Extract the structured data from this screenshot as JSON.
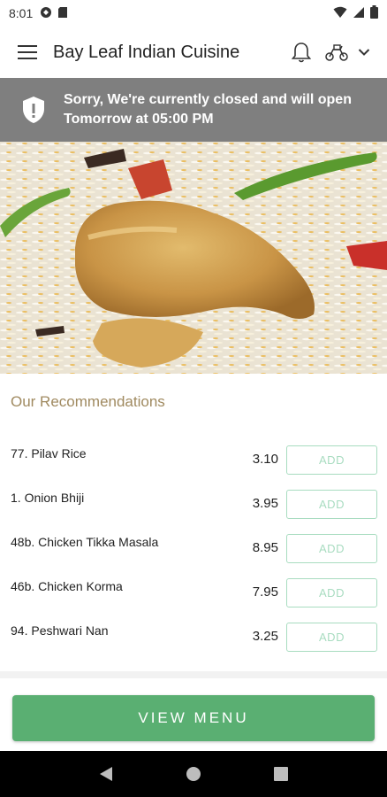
{
  "status_bar": {
    "time": "8:01",
    "icons_left": [
      "cloud-sync-icon",
      "sd-card-icon"
    ],
    "icons_right": [
      "wifi-icon",
      "cellular-signal-icon",
      "battery-icon"
    ]
  },
  "app_bar": {
    "title": "Bay Leaf Indian Cuisine",
    "icons": [
      "hamburger-menu-icon",
      "bell-icon",
      "scooter-delivery-icon",
      "chevron-down-icon"
    ]
  },
  "closed_banner": {
    "message_line1": "Sorry, We're currently closed and will open",
    "message_line2": "Tomorrow at 05:00 PM",
    "icon": "shield-alert-icon",
    "background": "#7f7f7f"
  },
  "hero": {
    "image": "biryani-with-chicken-leg-photo"
  },
  "recommendations": {
    "title": "Our Recommendations",
    "add_label": "ADD",
    "items": [
      {
        "name": "77. Pilav Rice",
        "price": "3.10"
      },
      {
        "name": "1. Onion Bhiji",
        "price": "3.95"
      },
      {
        "name": "48b. Chicken Tikka Masala",
        "price": "8.95"
      },
      {
        "name": "46b. Chicken Korma",
        "price": "7.95"
      },
      {
        "name": "94. Peshwari Nan",
        "price": "3.25"
      }
    ]
  },
  "view_menu": {
    "label": "VIEW MENU",
    "color": "#5aaf72"
  },
  "nav_bar": {
    "icons": [
      "back-icon",
      "home-icon",
      "recents-icon"
    ]
  },
  "colors": {
    "accent_green": "#5aaf72",
    "add_border": "#a8dcc0",
    "section_title": "#a08a60"
  }
}
